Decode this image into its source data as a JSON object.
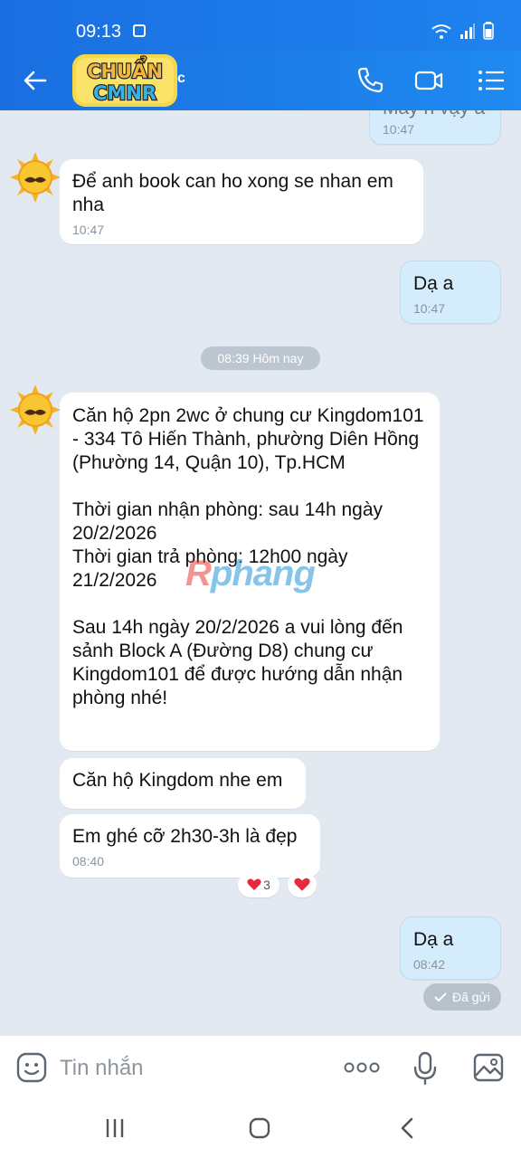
{
  "status_bar": {
    "time": "09:13"
  },
  "header": {
    "logo_alt": "CHUẨN CMNR",
    "logo_suffix": "c"
  },
  "messages": [
    {
      "id": "m0",
      "sender": "me",
      "text": "Mấy h vậy a",
      "time": "10:47"
    },
    {
      "id": "m1",
      "sender": "other",
      "text": "Để anh book can ho xong se nhan em nha",
      "time": "10:47"
    },
    {
      "id": "m2",
      "sender": "me",
      "text": "Dạ a",
      "time": "10:47"
    },
    {
      "id": "m3",
      "sender": "other",
      "text": "Căn hộ 2pn 2wc ở chung cư Kingdom101 - 334 Tô Hiến Thành, phường Diên Hồng (Phường 14, Quận 10), Tp.HCM\n\nThời gian nhận phòng: sau 14h ngày 20/2/2026\nThời gian trả phòng: 12h00 ngày 21/2/2026\n\nSau 14h ngày 20/2/2026 a vui lòng đến sảnh Block A (Đường D8) chung cư Kingdom101 để được hướng dẫn nhận phòng nhé!"
    },
    {
      "id": "m4",
      "sender": "other",
      "text": "Căn hộ Kingdom nhe em"
    },
    {
      "id": "m5",
      "sender": "other",
      "text": "Em ghé cỡ 2h30-3h là đẹp",
      "time": "08:40",
      "reaction_count": "3"
    },
    {
      "id": "m6",
      "sender": "me",
      "text": "Dạ a",
      "time": "08:42"
    }
  ],
  "date_separator": "08:39 Hôm nay",
  "sent_status": "Đã gửi",
  "watermark": {
    "r": "R",
    "rest": "phang"
  },
  "input": {
    "placeholder": "Tin nhắn"
  },
  "colors": {
    "header": "#1a6fe0",
    "bubble_me": "#d5ecfd",
    "bubble_other": "#ffffff",
    "chat_bg": "#e2e9f1",
    "heart": "#e8283c"
  }
}
